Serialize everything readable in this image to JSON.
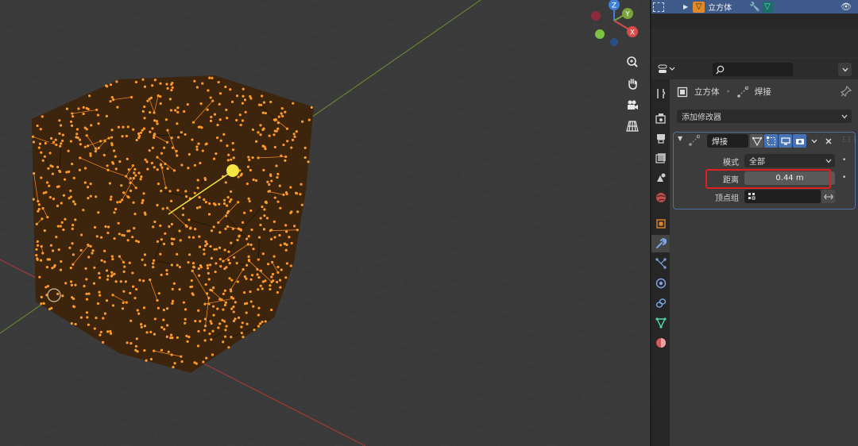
{
  "outliner": {
    "object_name": "立方体"
  },
  "properties": {
    "breadcrumb": {
      "object": "立方体",
      "modifier": "焊接"
    },
    "add_modifier_label": "添加修改器",
    "modifier": {
      "name": "焊接",
      "mode_label": "模式",
      "mode_value": "全部",
      "distance_label": "距离",
      "distance_value": "0.44 m",
      "vertex_group_label": "顶点组",
      "vertex_group_value": ""
    }
  },
  "gizmo": {
    "axes": [
      "X",
      "Y",
      "Z"
    ]
  },
  "colors": {
    "accent": "#4772b3",
    "selection": "#ff8c1a",
    "active_vertex": "#f5e641",
    "highlight": "#e02020",
    "axis_x": "#d94a4a",
    "axis_y": "#7aa33a",
    "axis_z": "#3d7fd9"
  },
  "icons": [
    "zoom-icon",
    "hand-pan-icon",
    "camera-icon",
    "grid-ortho-icon",
    "tool-tab-icon",
    "render-tab-icon",
    "output-tab-icon",
    "view-layer-tab-icon",
    "scene-tab-icon",
    "world-tab-icon",
    "object-tab-icon",
    "modifier-tab-icon",
    "particles-tab-icon",
    "physics-tab-icon",
    "constraints-tab-icon",
    "data-tab-icon",
    "material-tab-icon",
    "search-icon",
    "pin-icon",
    "close-icon",
    "visibility-eye-icon"
  ]
}
